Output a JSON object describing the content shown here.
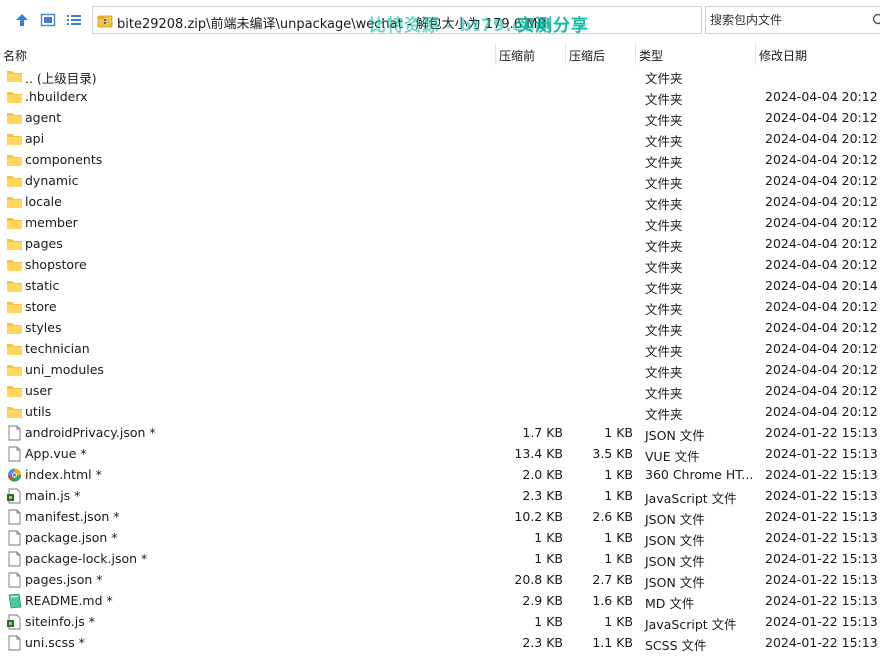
{
  "toolbar": {
    "path": "bite29208.zip\\前端未编译\\unpackage\\wechat - 解包大小为 179.6 MB",
    "watermark_main": "比特资源 - bt79.com",
    "watermark_share": "实测分享",
    "search_placeholder": "搜索包内文件"
  },
  "columns": {
    "name": "名称",
    "packed": "压缩前",
    "size": "压缩后",
    "type": "类型",
    "date": "修改日期"
  },
  "files": [
    {
      "name": ".. (上级目录)",
      "packed": "",
      "size": "",
      "type": "文件夹",
      "date": "",
      "icon": "folder-icon"
    },
    {
      "name": ".hbuilderx",
      "packed": "",
      "size": "",
      "type": "文件夹",
      "date": "2024-04-04 20:12",
      "icon": "folder-icon"
    },
    {
      "name": "agent",
      "packed": "",
      "size": "",
      "type": "文件夹",
      "date": "2024-04-04 20:12",
      "icon": "folder-icon"
    },
    {
      "name": "api",
      "packed": "",
      "size": "",
      "type": "文件夹",
      "date": "2024-04-04 20:12",
      "icon": "folder-icon"
    },
    {
      "name": "components",
      "packed": "",
      "size": "",
      "type": "文件夹",
      "date": "2024-04-04 20:12",
      "icon": "folder-icon"
    },
    {
      "name": "dynamic",
      "packed": "",
      "size": "",
      "type": "文件夹",
      "date": "2024-04-04 20:12",
      "icon": "folder-icon"
    },
    {
      "name": "locale",
      "packed": "",
      "size": "",
      "type": "文件夹",
      "date": "2024-04-04 20:12",
      "icon": "folder-icon"
    },
    {
      "name": "member",
      "packed": "",
      "size": "",
      "type": "文件夹",
      "date": "2024-04-04 20:12",
      "icon": "folder-icon"
    },
    {
      "name": "pages",
      "packed": "",
      "size": "",
      "type": "文件夹",
      "date": "2024-04-04 20:12",
      "icon": "folder-icon"
    },
    {
      "name": "shopstore",
      "packed": "",
      "size": "",
      "type": "文件夹",
      "date": "2024-04-04 20:12",
      "icon": "folder-icon"
    },
    {
      "name": "static",
      "packed": "",
      "size": "",
      "type": "文件夹",
      "date": "2024-04-04 20:14",
      "icon": "folder-icon"
    },
    {
      "name": "store",
      "packed": "",
      "size": "",
      "type": "文件夹",
      "date": "2024-04-04 20:12",
      "icon": "folder-icon"
    },
    {
      "name": "styles",
      "packed": "",
      "size": "",
      "type": "文件夹",
      "date": "2024-04-04 20:12",
      "icon": "folder-icon"
    },
    {
      "name": "technician",
      "packed": "",
      "size": "",
      "type": "文件夹",
      "date": "2024-04-04 20:12",
      "icon": "folder-icon"
    },
    {
      "name": "uni_modules",
      "packed": "",
      "size": "",
      "type": "文件夹",
      "date": "2024-04-04 20:12",
      "icon": "folder-icon"
    },
    {
      "name": "user",
      "packed": "",
      "size": "",
      "type": "文件夹",
      "date": "2024-04-04 20:12",
      "icon": "folder-icon"
    },
    {
      "name": "utils",
      "packed": "",
      "size": "",
      "type": "文件夹",
      "date": "2024-04-04 20:12",
      "icon": "folder-icon"
    },
    {
      "name": "androidPrivacy.json *",
      "packed": "1.7 KB",
      "size": "1 KB",
      "type": "JSON 文件",
      "date": "2024-01-22 15:13",
      "icon": "file-icon"
    },
    {
      "name": "App.vue *",
      "packed": "13.4 KB",
      "size": "3.5 KB",
      "type": "VUE 文件",
      "date": "2024-01-22 15:13",
      "icon": "file-icon"
    },
    {
      "name": "index.html *",
      "packed": "2.0 KB",
      "size": "1 KB",
      "type": "360 Chrome HT...",
      "date": "2024-01-22 15:13",
      "icon": "browser-icon"
    },
    {
      "name": "main.js *",
      "packed": "2.3 KB",
      "size": "1 KB",
      "type": "JavaScript 文件",
      "date": "2024-01-22 15:13",
      "icon": "script-file-icon"
    },
    {
      "name": "manifest.json *",
      "packed": "10.2 KB",
      "size": "2.6 KB",
      "type": "JSON 文件",
      "date": "2024-01-22 15:13",
      "icon": "file-icon"
    },
    {
      "name": "package.json *",
      "packed": "1 KB",
      "size": "1 KB",
      "type": "JSON 文件",
      "date": "2024-01-22 15:13",
      "icon": "file-icon"
    },
    {
      "name": "package-lock.json *",
      "packed": "1 KB",
      "size": "1 KB",
      "type": "JSON 文件",
      "date": "2024-01-22 15:13",
      "icon": "file-icon"
    },
    {
      "name": "pages.json *",
      "packed": "20.8 KB",
      "size": "2.7 KB",
      "type": "JSON 文件",
      "date": "2024-01-22 15:13",
      "icon": "file-icon"
    },
    {
      "name": "README.md *",
      "packed": "2.9 KB",
      "size": "1.6 KB",
      "type": "MD 文件",
      "date": "2024-01-22 15:13",
      "icon": "markdown-file-icon"
    },
    {
      "name": "siteinfo.js *",
      "packed": "1 KB",
      "size": "1 KB",
      "type": "JavaScript 文件",
      "date": "2024-01-22 15:13",
      "icon": "script-file-icon"
    },
    {
      "name": "uni.scss *",
      "packed": "2.3 KB",
      "size": "1.1 KB",
      "type": "SCSS 文件",
      "date": "2024-01-22 15:13",
      "icon": "file-icon"
    }
  ]
}
